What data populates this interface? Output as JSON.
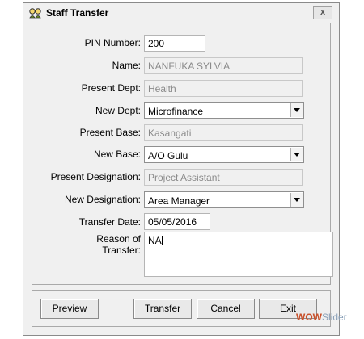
{
  "window": {
    "title": "Staff Transfer",
    "close_symbol": "x"
  },
  "form": {
    "pin": {
      "label": "PIN Number:",
      "value": "200"
    },
    "name": {
      "label": "Name:",
      "value": "NANFUKA SYLVIA"
    },
    "present_dept": {
      "label": "Present Dept:",
      "value": "Health"
    },
    "new_dept": {
      "label": "New Dept:",
      "value": "Microfinance"
    },
    "present_base": {
      "label": "Present Base:",
      "value": "Kasangati"
    },
    "new_base": {
      "label": "New Base:",
      "value": "A/O Gulu"
    },
    "present_designation": {
      "label": "Present Designation:",
      "value": "Project Assistant"
    },
    "new_designation": {
      "label": "New Designation:",
      "value": "Area Manager"
    },
    "transfer_date": {
      "label": "Transfer Date:",
      "value": "05/05/2016"
    },
    "reason": {
      "label_line1": "Reason of",
      "label_line2": "Transfer:",
      "value": "NA"
    }
  },
  "buttons": {
    "preview": "Preview",
    "transfer": "Transfer",
    "cancel": "Cancel",
    "exit": "Exit"
  },
  "watermark": {
    "part1": "WOW",
    "part2": "Slider"
  }
}
